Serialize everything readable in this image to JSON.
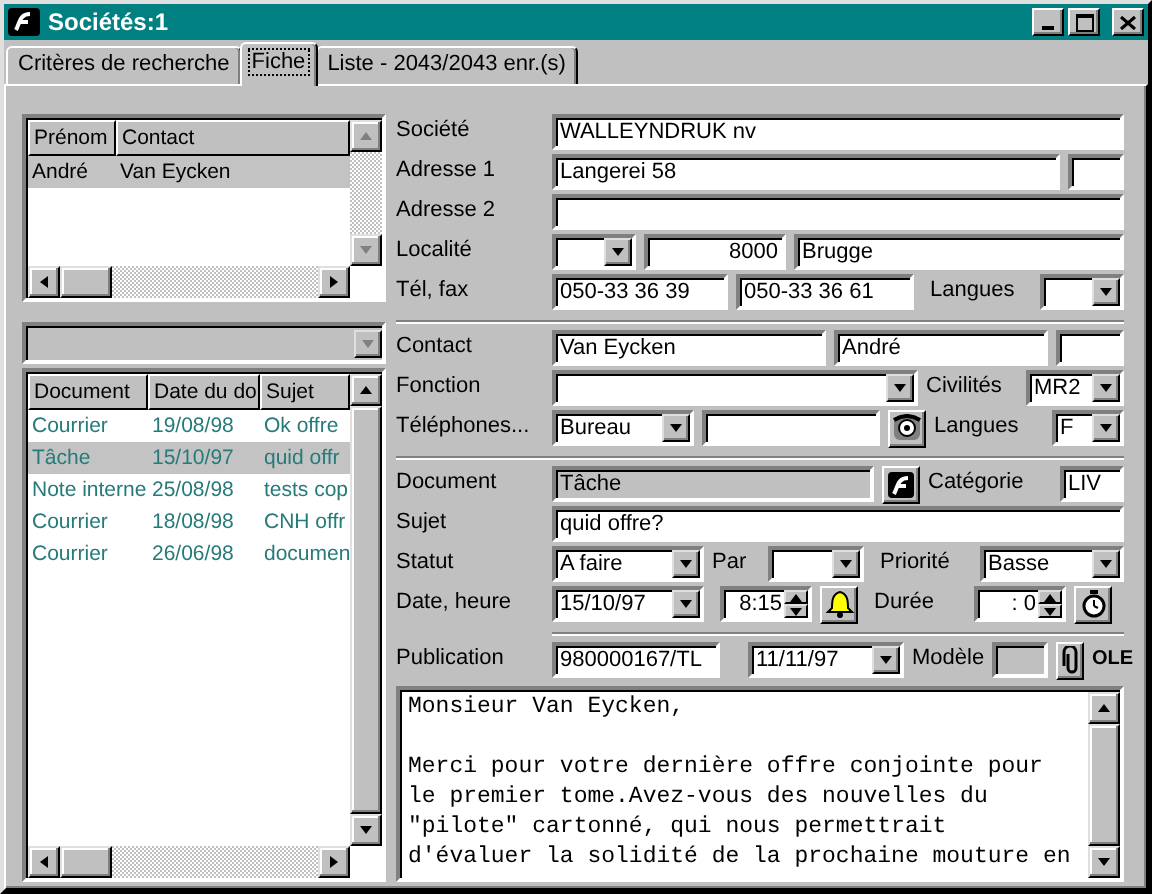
{
  "window": {
    "title": "Sociétés:1"
  },
  "tabs": [
    {
      "label": "Critères de recherche",
      "selected": false
    },
    {
      "label": "Fiche",
      "selected": true
    },
    {
      "label": "Liste - 2043/2043 enr.(s)",
      "selected": false
    }
  ],
  "contacts_list": {
    "columns": [
      "Prénom",
      "Contact"
    ],
    "rows": [
      {
        "cells": [
          "André",
          "Van Eycken"
        ],
        "selected": true
      }
    ]
  },
  "documents_list": {
    "columns": [
      "Document",
      "Date du do",
      "Sujet"
    ],
    "rows": [
      {
        "cells": [
          "Courrier",
          "19/08/98",
          "Ok offre"
        ],
        "selected": false
      },
      {
        "cells": [
          "Tâche",
          "15/10/97",
          "quid offr"
        ],
        "selected": true
      },
      {
        "cells": [
          "Note interne",
          "25/08/98",
          "tests cop"
        ],
        "selected": false
      },
      {
        "cells": [
          "Courrier",
          "18/08/98",
          "CNH offr"
        ],
        "selected": false
      },
      {
        "cells": [
          "Courrier",
          "26/06/98",
          "documen"
        ],
        "selected": false
      }
    ]
  },
  "societe": {
    "label": "Société",
    "value": "WALLEYNDRUK nv"
  },
  "adresse1": {
    "label": "Adresse 1",
    "value": "Langerei 58"
  },
  "adresse2": {
    "label": "Adresse 2"
  },
  "localite": {
    "label": "Localité",
    "postcode": "8000",
    "city": "Brugge"
  },
  "tel_fax": {
    "label": "Tél, fax",
    "phone": "050-33 36 39",
    "fax": "050-33 36 61",
    "languages_label": "Langues"
  },
  "contact": {
    "label": "Contact",
    "last_name": "Van Eycken",
    "first_name": "André"
  },
  "fonction": {
    "label": "Fonction",
    "civilites_label": "Civilités",
    "civilite": "MR2"
  },
  "telephones": {
    "label": "Téléphones...",
    "type": "Bureau",
    "languages_label": "Langues",
    "language": "F"
  },
  "document": {
    "label": "Document",
    "value": "Tâche",
    "category_label": "Catégorie",
    "category": "LIV"
  },
  "sujet": {
    "label": "Sujet",
    "value": "quid offre?"
  },
  "statut": {
    "label": "Statut",
    "value": "A faire",
    "par_label": "Par",
    "priority_label": "Priorité",
    "priority": "Basse"
  },
  "date_heure": {
    "label": "Date, heure",
    "date": "15/10/97",
    "time": "8:15",
    "duration_label": "Durée",
    "duration": ": 0"
  },
  "publication": {
    "label": "Publication",
    "value": "980000167/TL",
    "date": "11/11/97",
    "model_label": "Modèle",
    "ole_label": "OLE"
  },
  "note": {
    "text": "Monsieur Van Eycken,\n\nMerci pour votre dernière offre conjointe pour\nle premier tome.Avez-vous des nouvelles du\n\"pilote\" cartonné, qui nous permettrait\nd'évaluer la solidité de la prochaine mouture en"
  }
}
